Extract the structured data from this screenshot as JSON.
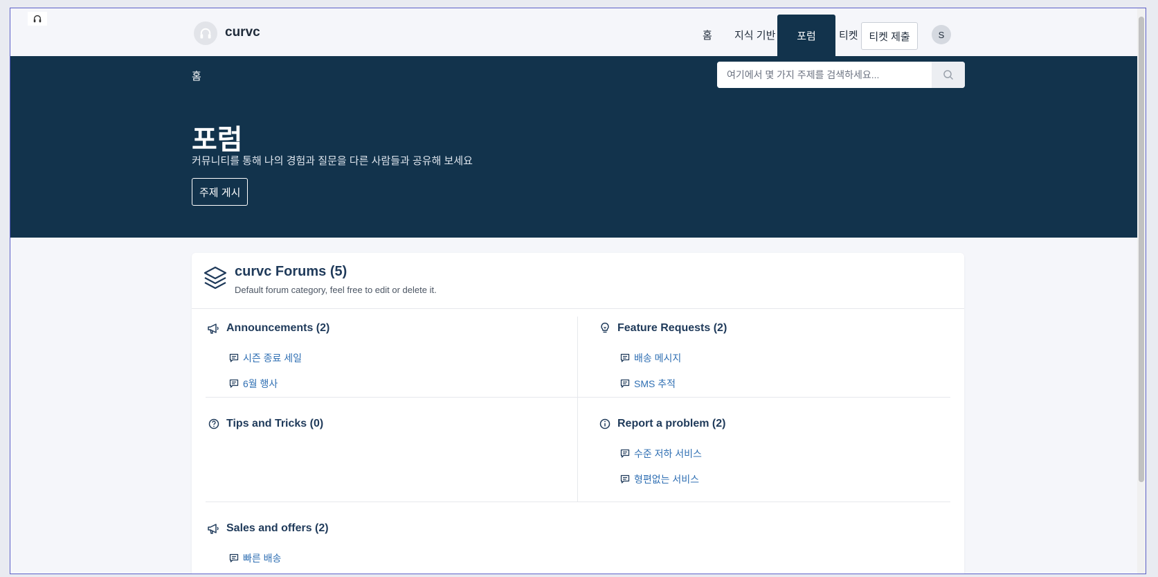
{
  "header": {
    "brand_name": "curvc",
    "nav": {
      "home": "홈",
      "knowledge_base": "지식 기반",
      "forum": "포럼",
      "tickets": "티켓",
      "submit_ticket": "티켓 제출"
    },
    "avatar_initial": "S"
  },
  "hero": {
    "breadcrumb": "홈",
    "search_placeholder": "여기에서 몇 가지 주제를 검색하세요...",
    "title": "포럼",
    "subtitle": "커뮤니티를 통해 나의 경험과 질문을 다른 사람들과 공유해 보세요",
    "post_button": "주제 게시"
  },
  "forum": {
    "title": "curvc Forums (5)",
    "description": "Default forum category, feel free to edit or delete it.",
    "categories": [
      {
        "title": "Announcements (2)",
        "icon": "megaphone-icon",
        "topics": [
          "시즌 종료 세일",
          "6월 행사"
        ]
      },
      {
        "title": "Feature Requests (2)",
        "icon": "lightbulb-icon",
        "topics": [
          "배송 메시지",
          "SMS 추적"
        ]
      },
      {
        "title": "Tips and Tricks (0)",
        "icon": "question-circle-icon",
        "topics": []
      },
      {
        "title": "Report a problem (2)",
        "icon": "info-circle-icon",
        "topics": [
          "수준 저하 서비스",
          "형편없는 서비스"
        ]
      },
      {
        "title": "Sales and offers (2)",
        "icon": "megaphone-icon",
        "topics": [
          "빠른 배송"
        ]
      }
    ]
  },
  "colors": {
    "hero_bg": "#12334c",
    "link": "#2f6fb3",
    "heading": "#1f3a5a",
    "page_bg": "#f5f6fa"
  }
}
